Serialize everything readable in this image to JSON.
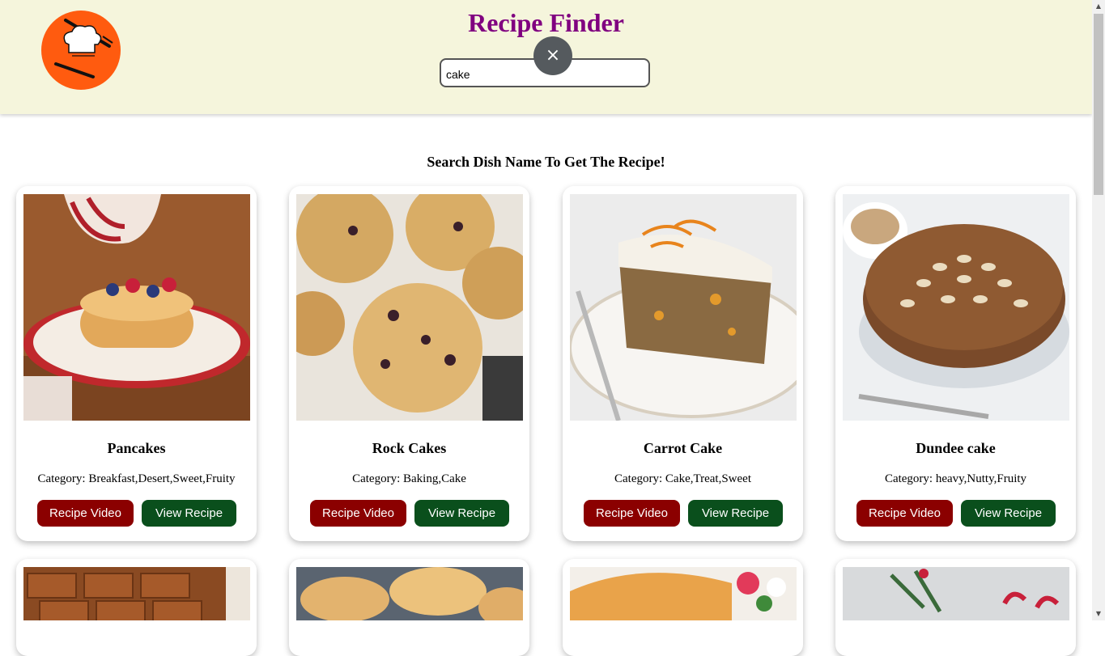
{
  "header": {
    "title": "Recipe Finder",
    "search_value": "cake",
    "close_icon": "×"
  },
  "subtitle": "Search Dish Name To Get The Recipe!",
  "recipes": [
    {
      "name": "Pancakes",
      "category": "Category: Breakfast,Desert,Sweet,Fruity",
      "video_label": "Recipe Video",
      "view_label": "View Recipe"
    },
    {
      "name": "Rock Cakes",
      "category": "Category: Baking,Cake",
      "video_label": "Recipe Video",
      "view_label": "View Recipe"
    },
    {
      "name": "Carrot Cake",
      "category": "Category: Cake,Treat,Sweet",
      "video_label": "Recipe Video",
      "view_label": "View Recipe"
    },
    {
      "name": "Dundee cake",
      "category": "Category: heavy,Nutty,Fruity",
      "video_label": "Recipe Video",
      "view_label": "View Recipe"
    }
  ],
  "colors": {
    "title": "#800080",
    "header_bg": "#f5f5dc",
    "logo": "#ff5b0f",
    "video_button": "#8b0000",
    "view_button": "#0a4f1c"
  },
  "icons": {
    "logo": "chef-hat-cutlery-icon",
    "close": "close-icon",
    "scroll_up": "▲",
    "scroll_down": "▼"
  }
}
